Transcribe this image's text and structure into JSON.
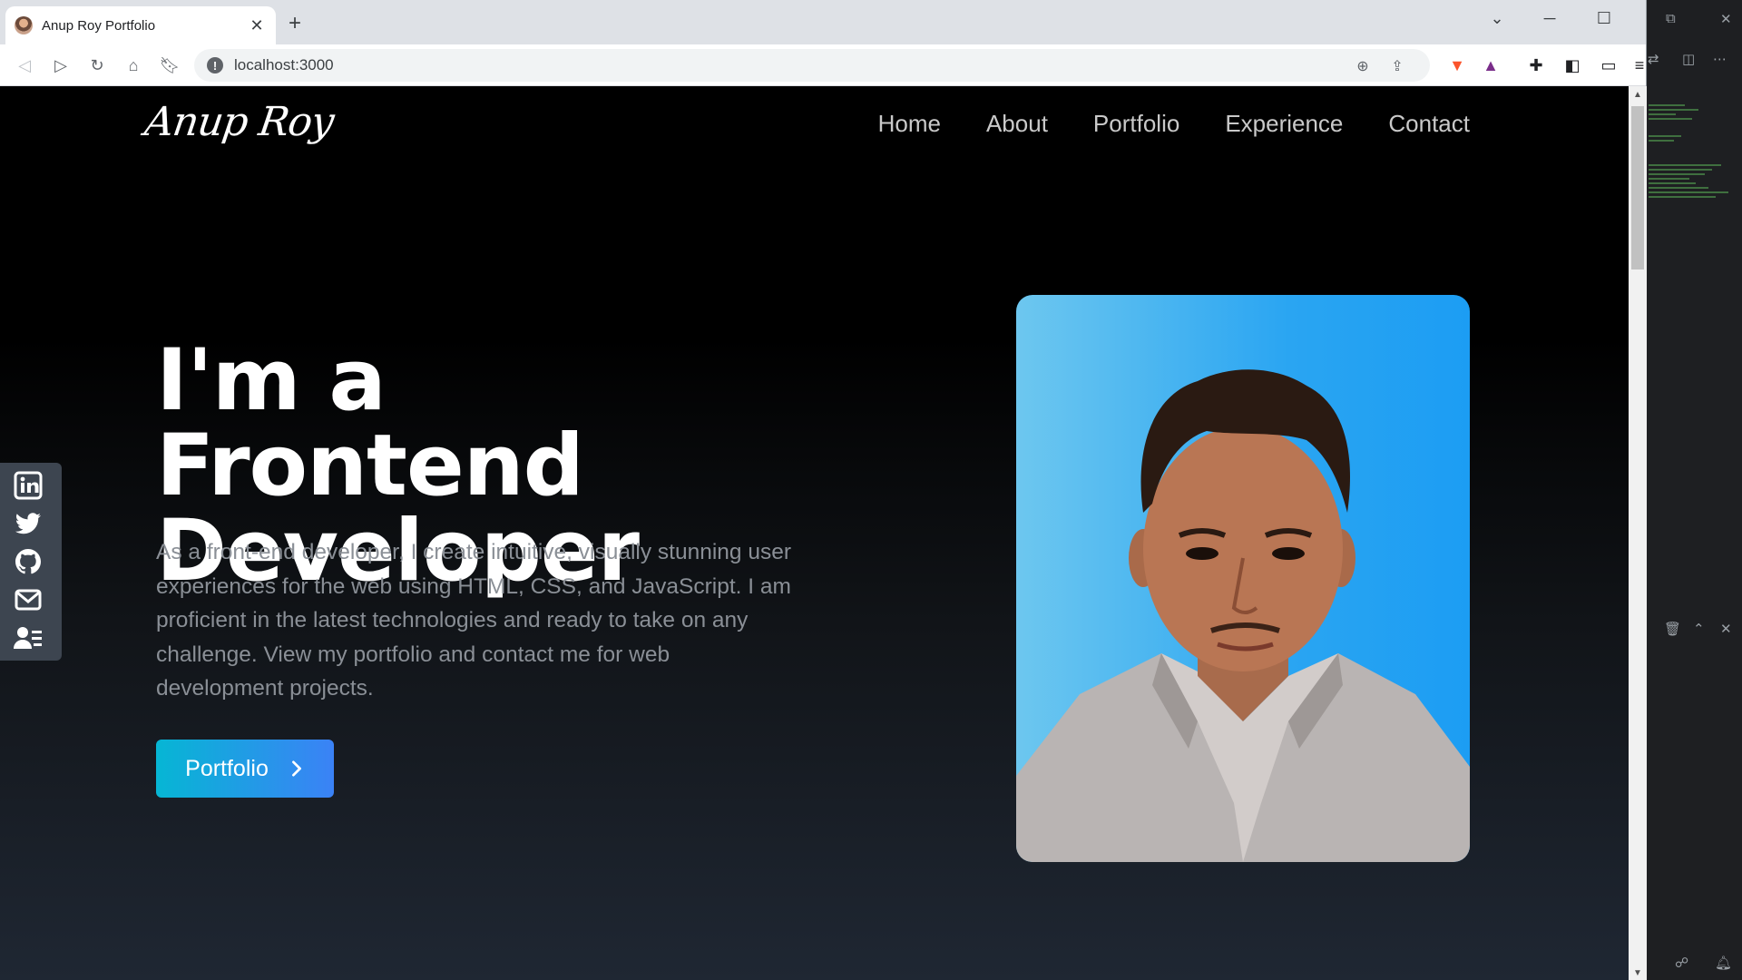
{
  "browser": {
    "tab_title": "Anup Roy Portfolio",
    "tab_close": "✕",
    "new_tab": "+",
    "url": "localhost:3000"
  },
  "site": {
    "logo": "Anup Roy",
    "nav": [
      "Home",
      "About",
      "Portfolio",
      "Experience",
      "Contact"
    ],
    "hero": {
      "title_line1": "I'm a Frontend",
      "title_line2": "Developer",
      "description": "As a front-end developer, I create intuitive, visually stunning user experiences for the web using HTML, CSS, and JavaScript. I am proficient in the latest technologies and ready to take on any challenge. View my portfolio and contact me for web development projects.",
      "cta_label": "Portfolio"
    },
    "social_icons": [
      "linkedin-icon",
      "twitter-icon",
      "github-icon",
      "mail-icon",
      "resume-icon"
    ]
  },
  "colors": {
    "cta_start": "#06b6d4",
    "cta_end": "#3b82f6",
    "photo_bg": "#1c9df3",
    "social_bar": "#3d4550"
  }
}
